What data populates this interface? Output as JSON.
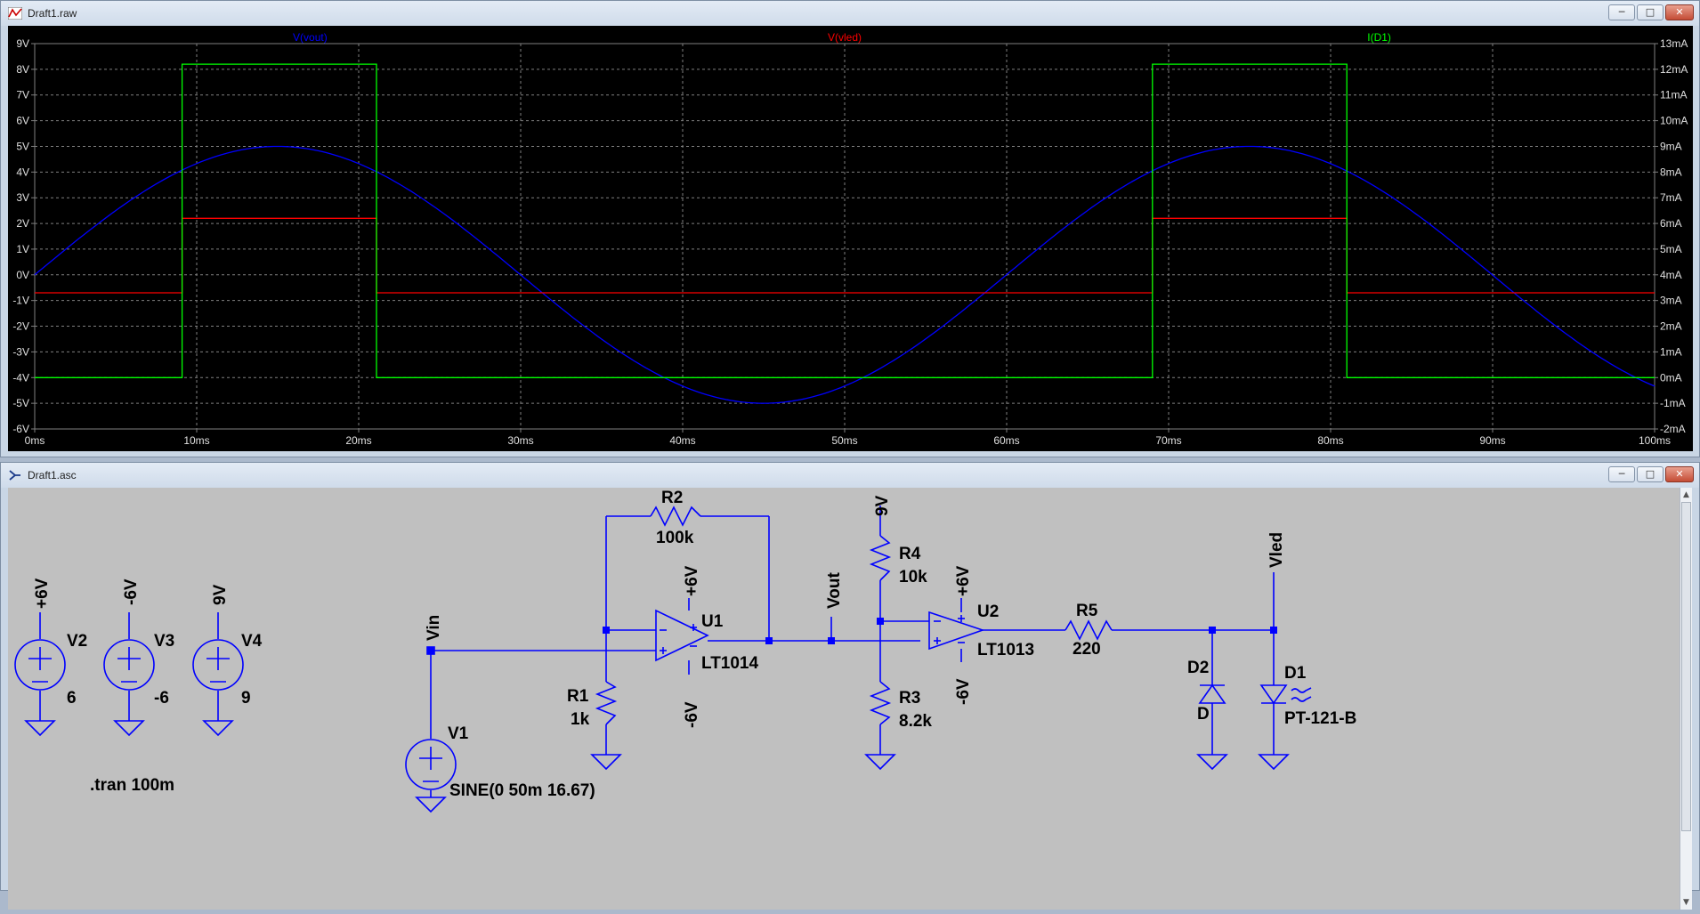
{
  "plot_window": {
    "title": "Draft1.raw",
    "buttons": {
      "minimize": "─",
      "maximize": "□",
      "close": "✕"
    }
  },
  "schematic_window": {
    "title": "Draft1.asc",
    "buttons": {
      "minimize": "─",
      "maximize": "□",
      "close": "✕"
    },
    "scroll_up": "▲",
    "scroll_down": "▼",
    "colors": {
      "wire": "#0000ff",
      "background": "#c0c0c0",
      "junction": "#0000ff",
      "text": "#000000"
    },
    "components": {
      "V2": {
        "name": "V2",
        "net": "+6V",
        "value": "6"
      },
      "V3": {
        "name": "V3",
        "net": "-6V",
        "value": "-6"
      },
      "V4": {
        "name": "V4",
        "net": "9V",
        "value": "9"
      },
      "V1": {
        "name": "V1",
        "value": "SINE(0 50m 16.67)"
      },
      "R1": {
        "name": "R1",
        "value": "1k"
      },
      "R2": {
        "name": "R2",
        "value": "100k"
      },
      "R3": {
        "name": "R3",
        "value": "8.2k"
      },
      "R4": {
        "name": "R4",
        "value": "10k"
      },
      "R5": {
        "name": "R5",
        "value": "220"
      },
      "U1": {
        "name": "U1",
        "value": "LT1014",
        "vpos": "+6V",
        "vneg": "-6V"
      },
      "U2": {
        "name": "U2",
        "value": "LT1013",
        "vpos": "+6V",
        "vneg": "-6V"
      },
      "D2": {
        "name": "D2",
        "value": "D"
      },
      "D1": {
        "name": "D1",
        "value": "PT-121-B"
      }
    },
    "net_labels": {
      "vin": "Vin",
      "vout": "Vout",
      "vled": "Vled",
      "r4_top": "9V"
    },
    "directive": ".tran 100m"
  },
  "chart_data": {
    "type": "line",
    "title": "",
    "x": {
      "label": "",
      "unit": "ms",
      "range": [
        0,
        100
      ],
      "ticks": [
        "0ms",
        "10ms",
        "20ms",
        "30ms",
        "40ms",
        "50ms",
        "60ms",
        "70ms",
        "80ms",
        "90ms",
        "100ms"
      ]
    },
    "y_left": {
      "unit": "V",
      "range": [
        -6,
        9
      ],
      "ticks": [
        "9V",
        "8V",
        "7V",
        "6V",
        "5V",
        "4V",
        "3V",
        "2V",
        "1V",
        "0V",
        "-1V",
        "-2V",
        "-3V",
        "-4V",
        "-5V",
        "-6V"
      ]
    },
    "y_right": {
      "unit": "mA",
      "range": [
        -2,
        13
      ],
      "ticks": [
        "13mA",
        "12mA",
        "11mA",
        "10mA",
        "9mA",
        "8mA",
        "7mA",
        "6mA",
        "5mA",
        "4mA",
        "3mA",
        "2mA",
        "1mA",
        "0mA",
        "-1mA",
        "-2mA"
      ]
    },
    "grid": true,
    "series": [
      {
        "name": "V(vout)",
        "axis": "left",
        "color": "#0000ff",
        "shape": "sine",
        "amplitude": 5,
        "frequency_hz": 16.67
      },
      {
        "name": "V(vled)",
        "axis": "left",
        "color": "#ff0000",
        "x": [
          0,
          9.1,
          9.1,
          21.1,
          21.1,
          69.0,
          69.0,
          81.0,
          81.0,
          100
        ],
        "y": [
          -0.7,
          -0.7,
          2.2,
          2.2,
          -0.7,
          -0.7,
          2.2,
          2.2,
          -0.7,
          -0.7
        ]
      },
      {
        "name": "I(D1)",
        "axis": "right",
        "color": "#00ff00",
        "x": [
          0,
          9.1,
          9.1,
          21.1,
          21.1,
          69.0,
          69.0,
          81.0,
          81.0,
          100
        ],
        "y": [
          0,
          0,
          12.2,
          12.2,
          0,
          0,
          12.2,
          12.2,
          0,
          0
        ]
      }
    ]
  }
}
